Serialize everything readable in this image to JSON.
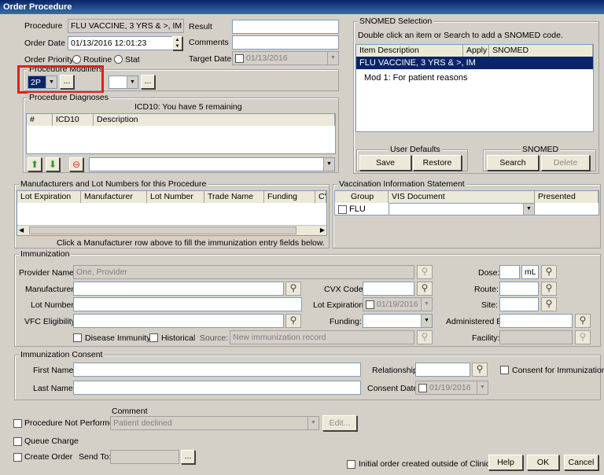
{
  "window": {
    "title": "Order Procedure"
  },
  "order": {
    "procedure_label": "Procedure",
    "procedure_value": "FLU VACCINE, 3 YRS & >, IM",
    "order_date_label": "Order Date",
    "order_date_value": "01/13/2016 12:01:23",
    "order_priority_label": "Order Priority",
    "routine_label": "Routine",
    "stat_label": "Stat",
    "result_label": "Result",
    "comments_label": "Comments",
    "target_date_label": "Target Date",
    "target_date_value": "01/13/2016"
  },
  "modifiers": {
    "group_label": "Procedure Modifiers",
    "mod1_value": "2P",
    "ellipsis": "..."
  },
  "diagnoses": {
    "group_label": "Procedure Diagnoses",
    "remaining": "ICD10: You have 5 remaining",
    "columns": [
      "#",
      "ICD10",
      "Description"
    ]
  },
  "snomed": {
    "group_label": "SNOMED Selection",
    "instruction": "Double click an item or Search to add a SNOMED code.",
    "columns": [
      "Item Description",
      "Apply",
      "SNOMED"
    ],
    "rows": [
      "FLU VACCINE, 3 YRS & >, IM",
      "Mod 1: For patient reasons"
    ],
    "user_defaults_label": "User Defaults",
    "save_label": "Save",
    "restore_label": "Restore",
    "snomed_box_label": "SNOMED",
    "search_label": "Search",
    "delete_label": "Delete"
  },
  "manufacturers": {
    "group_label": "Manufacturers and Lot Numbers for this Procedure",
    "columns": [
      "Lot Expiration",
      "Manufacturer",
      "Lot Number",
      "Trade Name",
      "Funding",
      "CV"
    ],
    "hint": "Click a Manufacturer row above to fill the immunization entry fields below."
  },
  "vis": {
    "group_label": "Vaccination Information Statement",
    "columns": [
      "Group",
      "VIS Document",
      "Presented"
    ],
    "row_group": "FLU"
  },
  "immunization": {
    "group_label": "Immunization",
    "provider_label": "Provider Name:",
    "provider_value": "One, Provider",
    "dose_label": "Dose:",
    "dose_unit": "mL",
    "manufacturer_label": "Manufacturer:",
    "cvx_label": "CVX Code:",
    "route_label": "Route:",
    "lot_number_label": "Lot Number:",
    "lot_exp_label": "Lot Expiration:",
    "lot_exp_value": "01/19/2016",
    "site_label": "Site:",
    "vfc_label": "VFC Eligibility:",
    "funding_label": "Funding:",
    "administered_by_label": "Administered By:",
    "disease_immunity_label": "Disease Immunity",
    "historical_label": "Historical",
    "source_label": "Source:",
    "source_value": "New immunization record",
    "facility_label": "Facility:"
  },
  "consent": {
    "group_label": "Immunization Consent",
    "first_name_label": "First Name:",
    "last_name_label": "Last Name:",
    "relationship_label": "Relationship:",
    "consent_date_label": "Consent Date:",
    "consent_date_value": "01/19/2016",
    "consent_for_label": "Consent for Immunization"
  },
  "footer": {
    "comment_label": "Comment",
    "procedure_not_performed_label": "Procedure Not Performed",
    "comment_value": "Patient declined",
    "edit_label": "Edit...",
    "queue_charge_label": "Queue Charge",
    "create_order_label": "Create Order",
    "send_to_label": "Send To:",
    "initial_order_label": "Initial order created outside of Clinical",
    "help_label": "Help",
    "ok_label": "OK",
    "cancel_label": "Cancel"
  },
  "highlight": {
    "color": "#e02020"
  }
}
